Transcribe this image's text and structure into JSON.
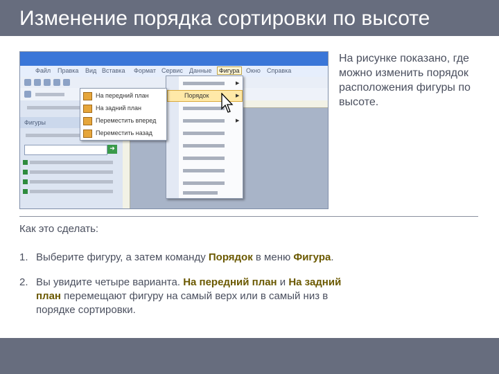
{
  "header": {
    "title": "Изменение порядка сортировки по высоте"
  },
  "screenshot": {
    "menubar": [
      "Файл",
      "Правка",
      "Вид",
      "Вставка",
      "Формат",
      "Сервис",
      "Данные",
      "Фигура",
      "Окно",
      "Справка"
    ],
    "active_menu": "Фигура",
    "left_panel_label": "Фигуры",
    "shape_menu_highlight": "Порядок",
    "order_submenu": [
      "На передний план",
      "На задний план",
      "Переместить вперед",
      "Переместить назад"
    ]
  },
  "side_text": "На рисунке показано, где можно изменить порядок расположения фигуры по высоте.",
  "howto": "Как это сделать:",
  "steps": [
    {
      "num": "1.",
      "pre": "Выберите фигуру, а затем команду ",
      "b1": "Порядок",
      "mid": " в меню ",
      "b2": "Фигура",
      "post": "."
    },
    {
      "num": "2.",
      "pre": "Вы увидите четыре варианта. ",
      "b1": "На передний план",
      "mid": " и ",
      "b2": "На задний план",
      "post": " перемещают фигуру на самый верх или в самый низ в порядке сортировки."
    }
  ],
  "colors": {
    "bar": "#676d7e",
    "text": "#4a4f5e",
    "highlight": "#6b5900"
  }
}
